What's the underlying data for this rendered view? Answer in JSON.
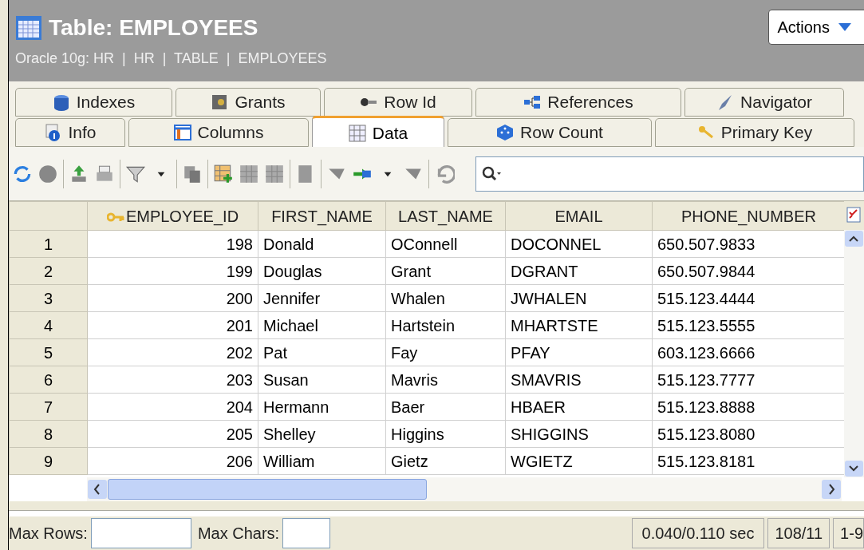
{
  "header": {
    "title": "Table: EMPLOYEES",
    "breadcrumb": "Oracle 10g: HR  |  HR  |  TABLE  |  EMPLOYEES",
    "actions": "Actions"
  },
  "tab_rows": [
    [
      {
        "label": "Indexes",
        "selected": false
      },
      {
        "label": "Grants",
        "selected": false
      },
      {
        "label": "Row Id",
        "selected": false
      },
      {
        "label": "References",
        "selected": false
      },
      {
        "label": "Navigator",
        "selected": false
      }
    ],
    [
      {
        "label": "Info",
        "selected": false
      },
      {
        "label": "Columns",
        "selected": false
      },
      {
        "label": "Data",
        "selected": true
      },
      {
        "label": "Row Count",
        "selected": false
      },
      {
        "label": "Primary Key",
        "selected": false
      }
    ]
  ],
  "table": {
    "columns": [
      {
        "key_icon": false
      },
      {
        "label": "EMPLOYEE_ID",
        "key_icon": true
      },
      {
        "label": "FIRST_NAME",
        "key_icon": false
      },
      {
        "label": "LAST_NAME",
        "key_icon": false
      },
      {
        "label": "EMAIL",
        "key_icon": false
      },
      {
        "label": "PHONE_NUMBER",
        "key_icon": false
      }
    ],
    "rows": [
      [
        "1",
        "198",
        "Donald",
        "OConnell",
        "DOCONNEL",
        "650.507.9833"
      ],
      [
        "2",
        "199",
        "Douglas",
        "Grant",
        "DGRANT",
        "650.507.9844"
      ],
      [
        "3",
        "200",
        "Jennifer",
        "Whalen",
        "JWHALEN",
        "515.123.4444"
      ],
      [
        "4",
        "201",
        "Michael",
        "Hartstein",
        "MHARTSTE",
        "515.123.5555"
      ],
      [
        "5",
        "202",
        "Pat",
        "Fay",
        "PFAY",
        "603.123.6666"
      ],
      [
        "6",
        "203",
        "Susan",
        "Mavris",
        "SMAVRIS",
        "515.123.7777"
      ],
      [
        "7",
        "204",
        "Hermann",
        "Baer",
        "HBAER",
        "515.123.8888"
      ],
      [
        "8",
        "205",
        "Shelley",
        "Higgins",
        "SHIGGINS",
        "515.123.8080"
      ],
      [
        "9",
        "206",
        "William",
        "Gietz",
        "WGIETZ",
        "515.123.8181"
      ]
    ]
  },
  "status_bar": {
    "max_rows_label": "Max Rows:",
    "max_chars_label": "Max Chars:",
    "timing": "0.040/0.110 sec",
    "counts": "108/11",
    "range": "1-9"
  }
}
